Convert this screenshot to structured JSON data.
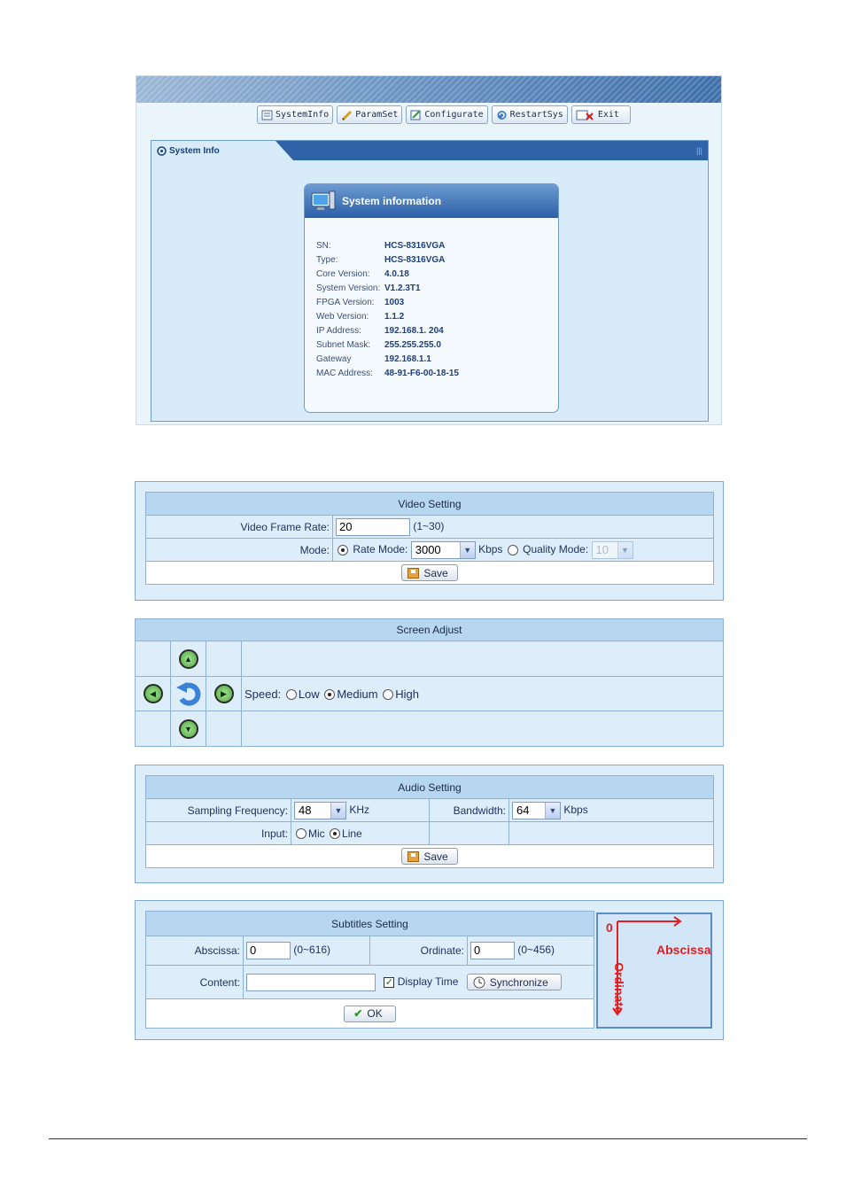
{
  "toolbar": {
    "items": [
      {
        "label": "SystemInfo"
      },
      {
        "label": "ParamSet"
      },
      {
        "label": "Configurate"
      },
      {
        "label": "RestartSys"
      },
      {
        "label": "Exit"
      }
    ]
  },
  "system_info": {
    "tab_label": "System Info",
    "box_title": "System information",
    "rows": [
      {
        "key": "SN:",
        "value": "HCS-8316VGA"
      },
      {
        "key": "Type:",
        "value": "HCS-8316VGA"
      },
      {
        "key": "Core Version:",
        "value": "4.0.18"
      },
      {
        "key": "System Version:",
        "value": "V1.2.3T1"
      },
      {
        "key": "FPGA Version:",
        "value": "1003"
      },
      {
        "key": "Web Version:",
        "value": "1.1.2"
      },
      {
        "key": "IP Address:",
        "value": "192.168.1. 204"
      },
      {
        "key": "Subnet Mask:",
        "value": "255.255.255.0"
      },
      {
        "key": "Gateway",
        "value": "192.168.1.1"
      },
      {
        "key": "MAC Address:",
        "value": "48-91-F6-00-18-15"
      }
    ]
  },
  "video": {
    "title": "Video Setting",
    "frame_rate_label": "Video Frame Rate:",
    "frame_rate_value": "20",
    "frame_rate_range": "(1~30)",
    "mode_label": "Mode:",
    "rate_mode_label": "Rate Mode:",
    "rate_mode_value": "3000",
    "rate_unit": "Kbps",
    "quality_mode_label": "Quality Mode:",
    "quality_mode_value": "10",
    "save_label": "Save"
  },
  "screen": {
    "title": "Screen Adjust",
    "speed_label": "Speed:",
    "speed_low": "Low",
    "speed_medium": "Medium",
    "speed_high": "High",
    "speed_selected": "Medium"
  },
  "audio": {
    "title": "Audio Setting",
    "sampling_label": "Sampling Frequency:",
    "sampling_value": "48",
    "sampling_unit": "KHz",
    "bandwidth_label": "Bandwidth:",
    "bandwidth_value": "64",
    "bandwidth_unit": "Kbps",
    "input_label": "Input:",
    "input_mic": "Mic",
    "input_line": "Line",
    "input_selected": "Line",
    "save_label": "Save"
  },
  "subtitles": {
    "title": "Subtitles Setting",
    "abscissa_label": "Abscissa:",
    "abscissa_value": "0",
    "abscissa_range": "(0~616)",
    "ordinate_label": "Ordinate:",
    "ordinate_value": "0",
    "ordinate_range": "(0~456)",
    "content_label": "Content:",
    "content_value": "",
    "display_time_label": "Display Time",
    "display_time_checked": true,
    "sync_label": "Synchronize",
    "ok_label": "OK",
    "diagram_origin": "0",
    "diagram_x_label": "Abscissa",
    "diagram_y_label": "Ordinate"
  },
  "colors": {
    "panel_bg": "#ddeefa",
    "header_bg": "#b7d6ef",
    "diagram_red": "#e02020"
  }
}
